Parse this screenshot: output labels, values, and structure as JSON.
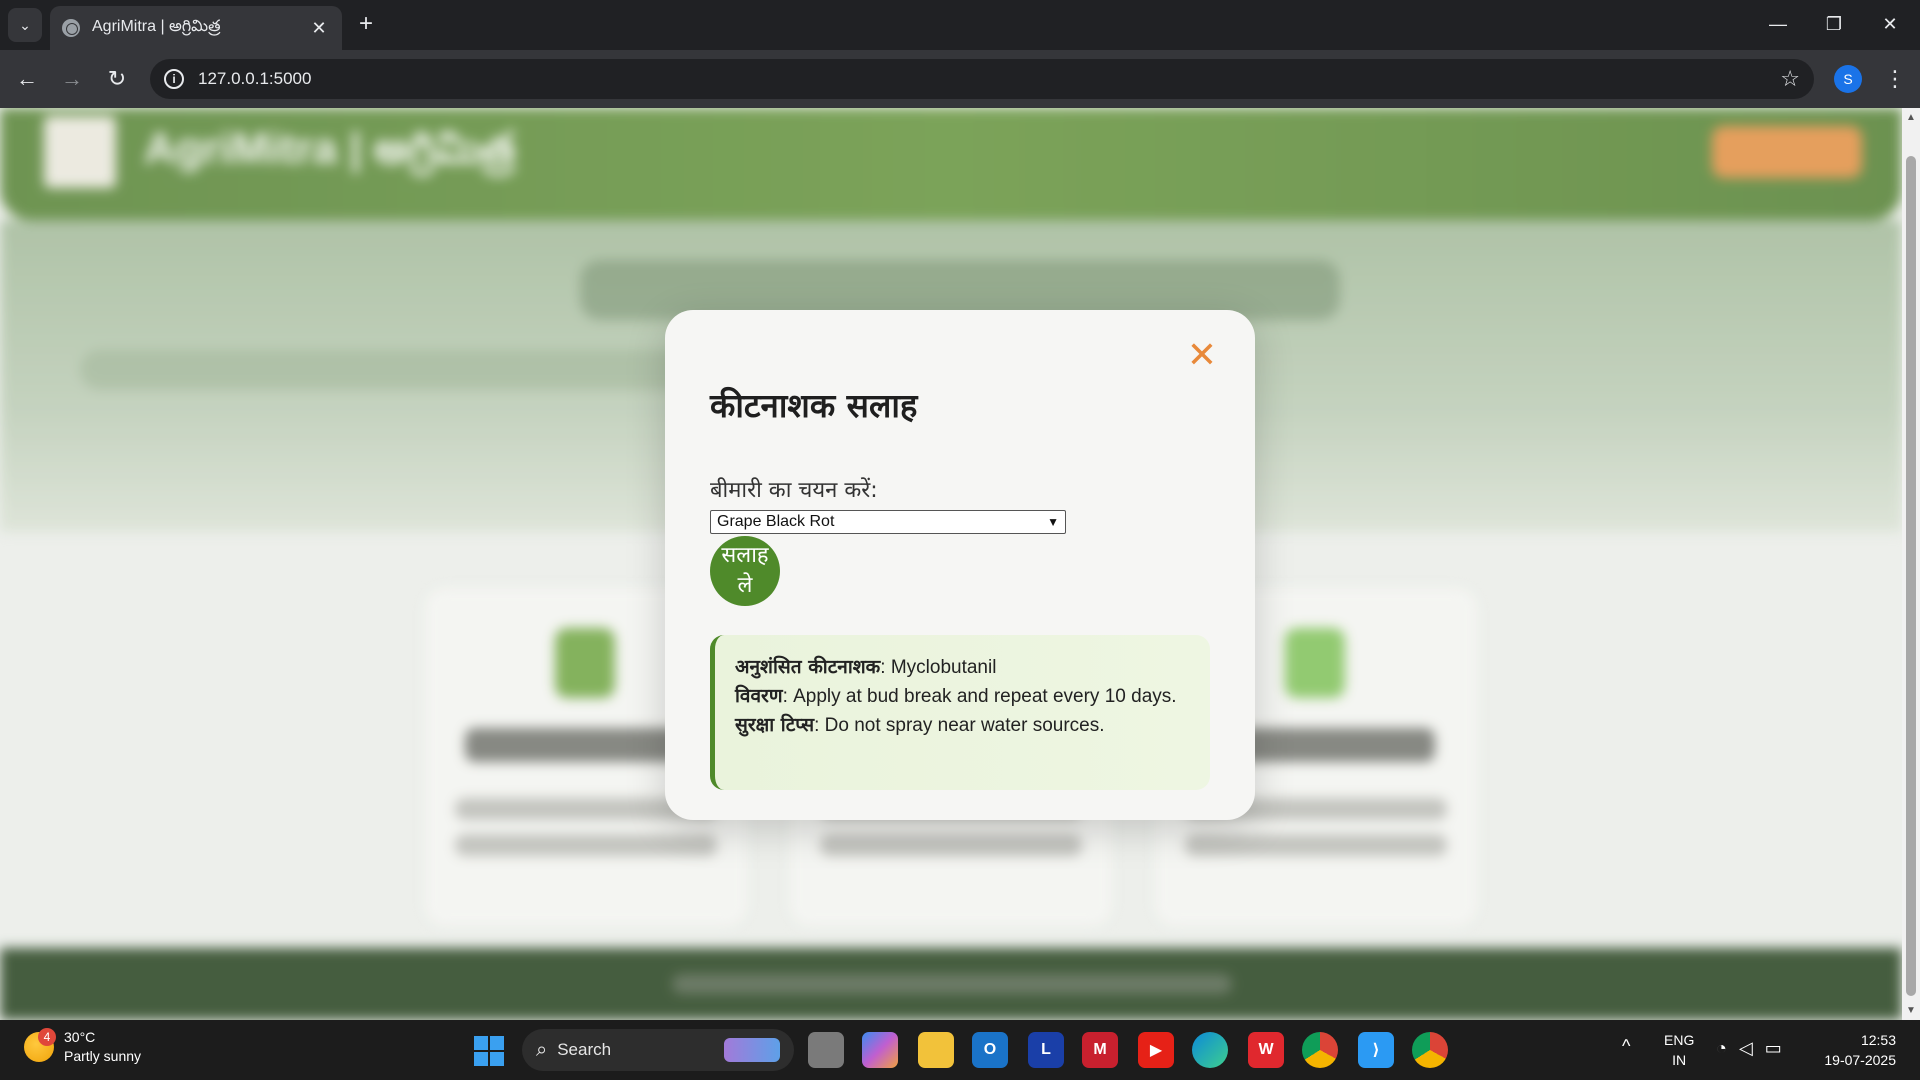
{
  "browser": {
    "tab_title": "AgriMitra | అగ్రిమిత్ర",
    "url": "127.0.0.1:5000",
    "profile_initial": "S",
    "new_tab_label": "+",
    "close_tab_glyph": "✕"
  },
  "modal": {
    "title": "कीटनाशक सलाह",
    "close_glyph": "✕",
    "select_label": "बीमारी का चयन करें:",
    "selected_disease": "Grape Black Rot",
    "submit_label": "सलाह ले",
    "result": {
      "pesticide_key": "अनुशंसित कीटनाशक",
      "pesticide_value": ": Myclobutanil",
      "description_key": "विवरण",
      "description_value": ": Apply at bud break and repeat every 10 days.",
      "safety_key": "सुरक्षा टिप्स",
      "safety_value": ": Do not spray near water sources."
    },
    "accent_color": "#4f8a2a",
    "close_color": "#e8893a"
  },
  "taskbar": {
    "weather_temp": "30°C",
    "weather_desc": "Partly sunny",
    "weather_badge": "4",
    "search_label": "Search",
    "lang_line1": "ENG",
    "lang_line2": "IN",
    "time": "12:53",
    "date": "19-07-2025",
    "apps": [
      "task-view",
      "copilot",
      "file-explorer",
      "outlook",
      "l-app",
      "mcafee",
      "youtube",
      "edge",
      "wps-office",
      "chrome-profile-s",
      "vscode",
      "chrome-active"
    ]
  }
}
